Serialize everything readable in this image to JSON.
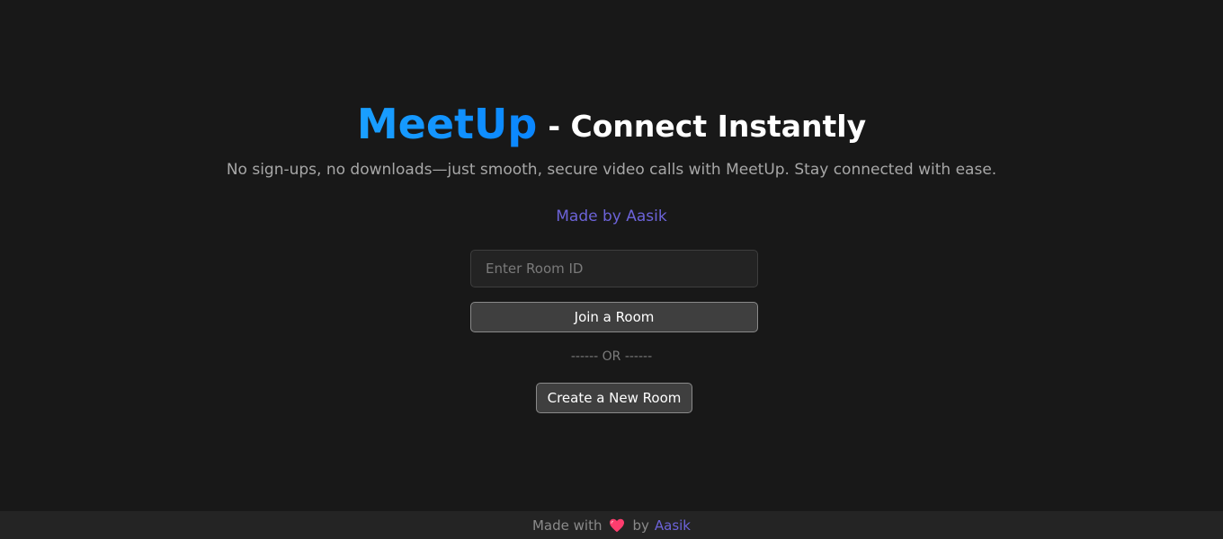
{
  "hero": {
    "brand": "MeetUp",
    "tagline": "- Connect Instantly",
    "subtitle": "No sign-ups, no downloads—just smooth, secure video calls with MeetUp. Stay connected with ease.",
    "made_by_prefix": "Made by ",
    "made_by_author": "Aasik"
  },
  "form": {
    "room_input_placeholder": "Enter Room ID",
    "room_input_value": "",
    "join_label": "Join a Room",
    "divider": "------ OR ------",
    "create_label": "Create a New Room"
  },
  "footer": {
    "prefix": "Made with",
    "icon": "heart-icon",
    "by": "by",
    "author": "Aasik"
  },
  "colors": {
    "background": "#181818",
    "brand_gradient_start": "#1aa0ff",
    "brand_gradient_end": "#0a86ff",
    "accent": "#6c63d8",
    "heart": "#ff3d6e"
  }
}
